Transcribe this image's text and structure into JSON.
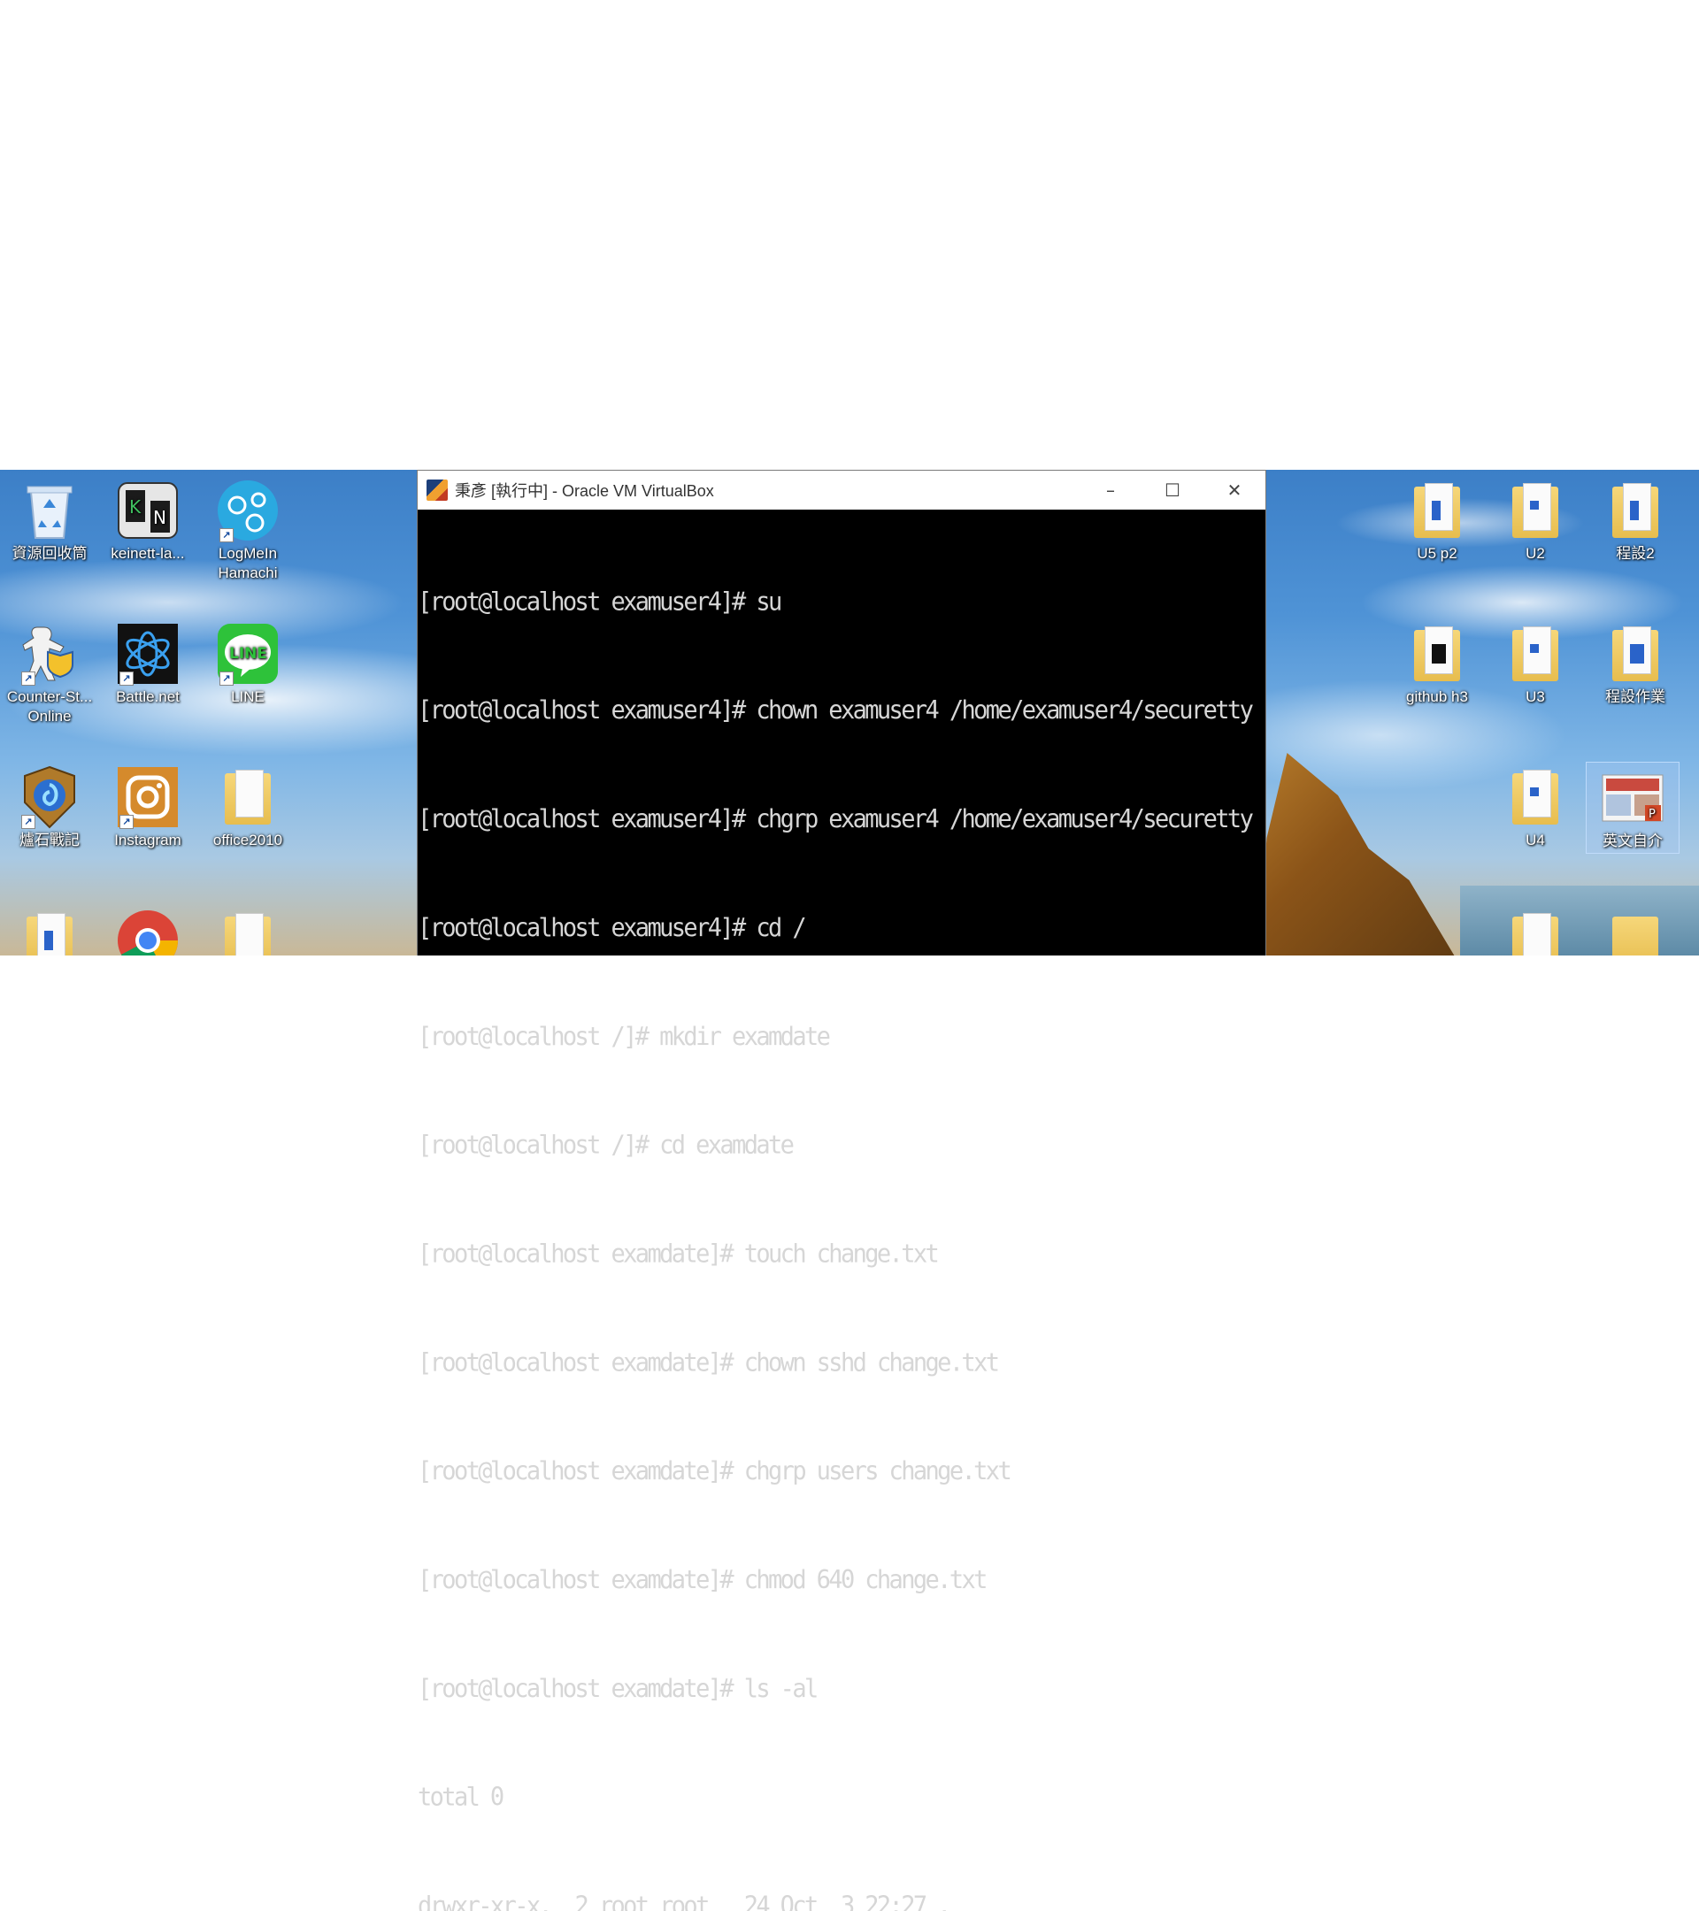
{
  "desktop": {
    "icons_left": [
      {
        "label": "資源回收筒",
        "icon": "recycle-bin-icon",
        "shortcut": false
      },
      {
        "label": "keinett-la...",
        "icon": "kn-app-icon",
        "shortcut": false
      },
      {
        "label": "LogMeIn\nHamachi",
        "icon": "hamachi-icon",
        "shortcut": true
      },
      {
        "label": "Counter-St...\nOnline",
        "icon": "counter-strike-icon",
        "shortcut": true
      },
      {
        "label": "Battle.net",
        "icon": "battlenet-icon",
        "shortcut": true
      },
      {
        "label": "LINE",
        "icon": "line-icon",
        "shortcut": true
      },
      {
        "label": "爐石戰記",
        "icon": "hearthstone-icon",
        "shortcut": true
      },
      {
        "label": "Instagram",
        "icon": "instagram-icon",
        "shortcut": true
      },
      {
        "label": "office2010",
        "icon": "folder-icon",
        "shortcut": false
      }
    ],
    "icons_right": [
      {
        "label": "U5 p2",
        "icon": "folder-icon"
      },
      {
        "label": "U2",
        "icon": "folder-icon"
      },
      {
        "label": "程設2",
        "icon": "folder-icon"
      },
      {
        "label": "github h3",
        "icon": "folder-icon"
      },
      {
        "label": "U3",
        "icon": "folder-icon"
      },
      {
        "label": "程設作業",
        "icon": "folder-icon"
      },
      {
        "label": "U4",
        "icon": "folder-icon"
      },
      {
        "label": "英文自介",
        "icon": "powerpoint-file-icon"
      }
    ]
  },
  "vbox": {
    "title": "秉彥 [執行中] - Oracle VM VirtualBox",
    "minimize": "–",
    "maximize": "☐",
    "close": "✕",
    "terminal_lines": [
      "[root@localhost examuser4]# su",
      "[root@localhost examuser4]# chown examuser4 /home/examuser4/securetty",
      "[root@localhost examuser4]# chgrp examuser4 /home/examuser4/securetty",
      "[root@localhost examuser4]# cd /",
      "[root@localhost /]# mkdir examdate",
      "[root@localhost /]# cd examdate",
      "[root@localhost examdate]# touch change.txt",
      "[root@localhost examdate]# chown sshd change.txt",
      "[root@localhost examdate]# chgrp users change.txt",
      "[root@localhost examdate]# chmod 640 change.txt",
      "[root@localhost examdate]# ls -al",
      "total 0",
      "drwxr-xr-x.  2 root root   24 Oct  3 22:27 ."
    ]
  },
  "colors": {
    "terminal_bg": "#000000",
    "terminal_fg": "#d6d6d6",
    "titlebar_bg": "#ffffff"
  }
}
